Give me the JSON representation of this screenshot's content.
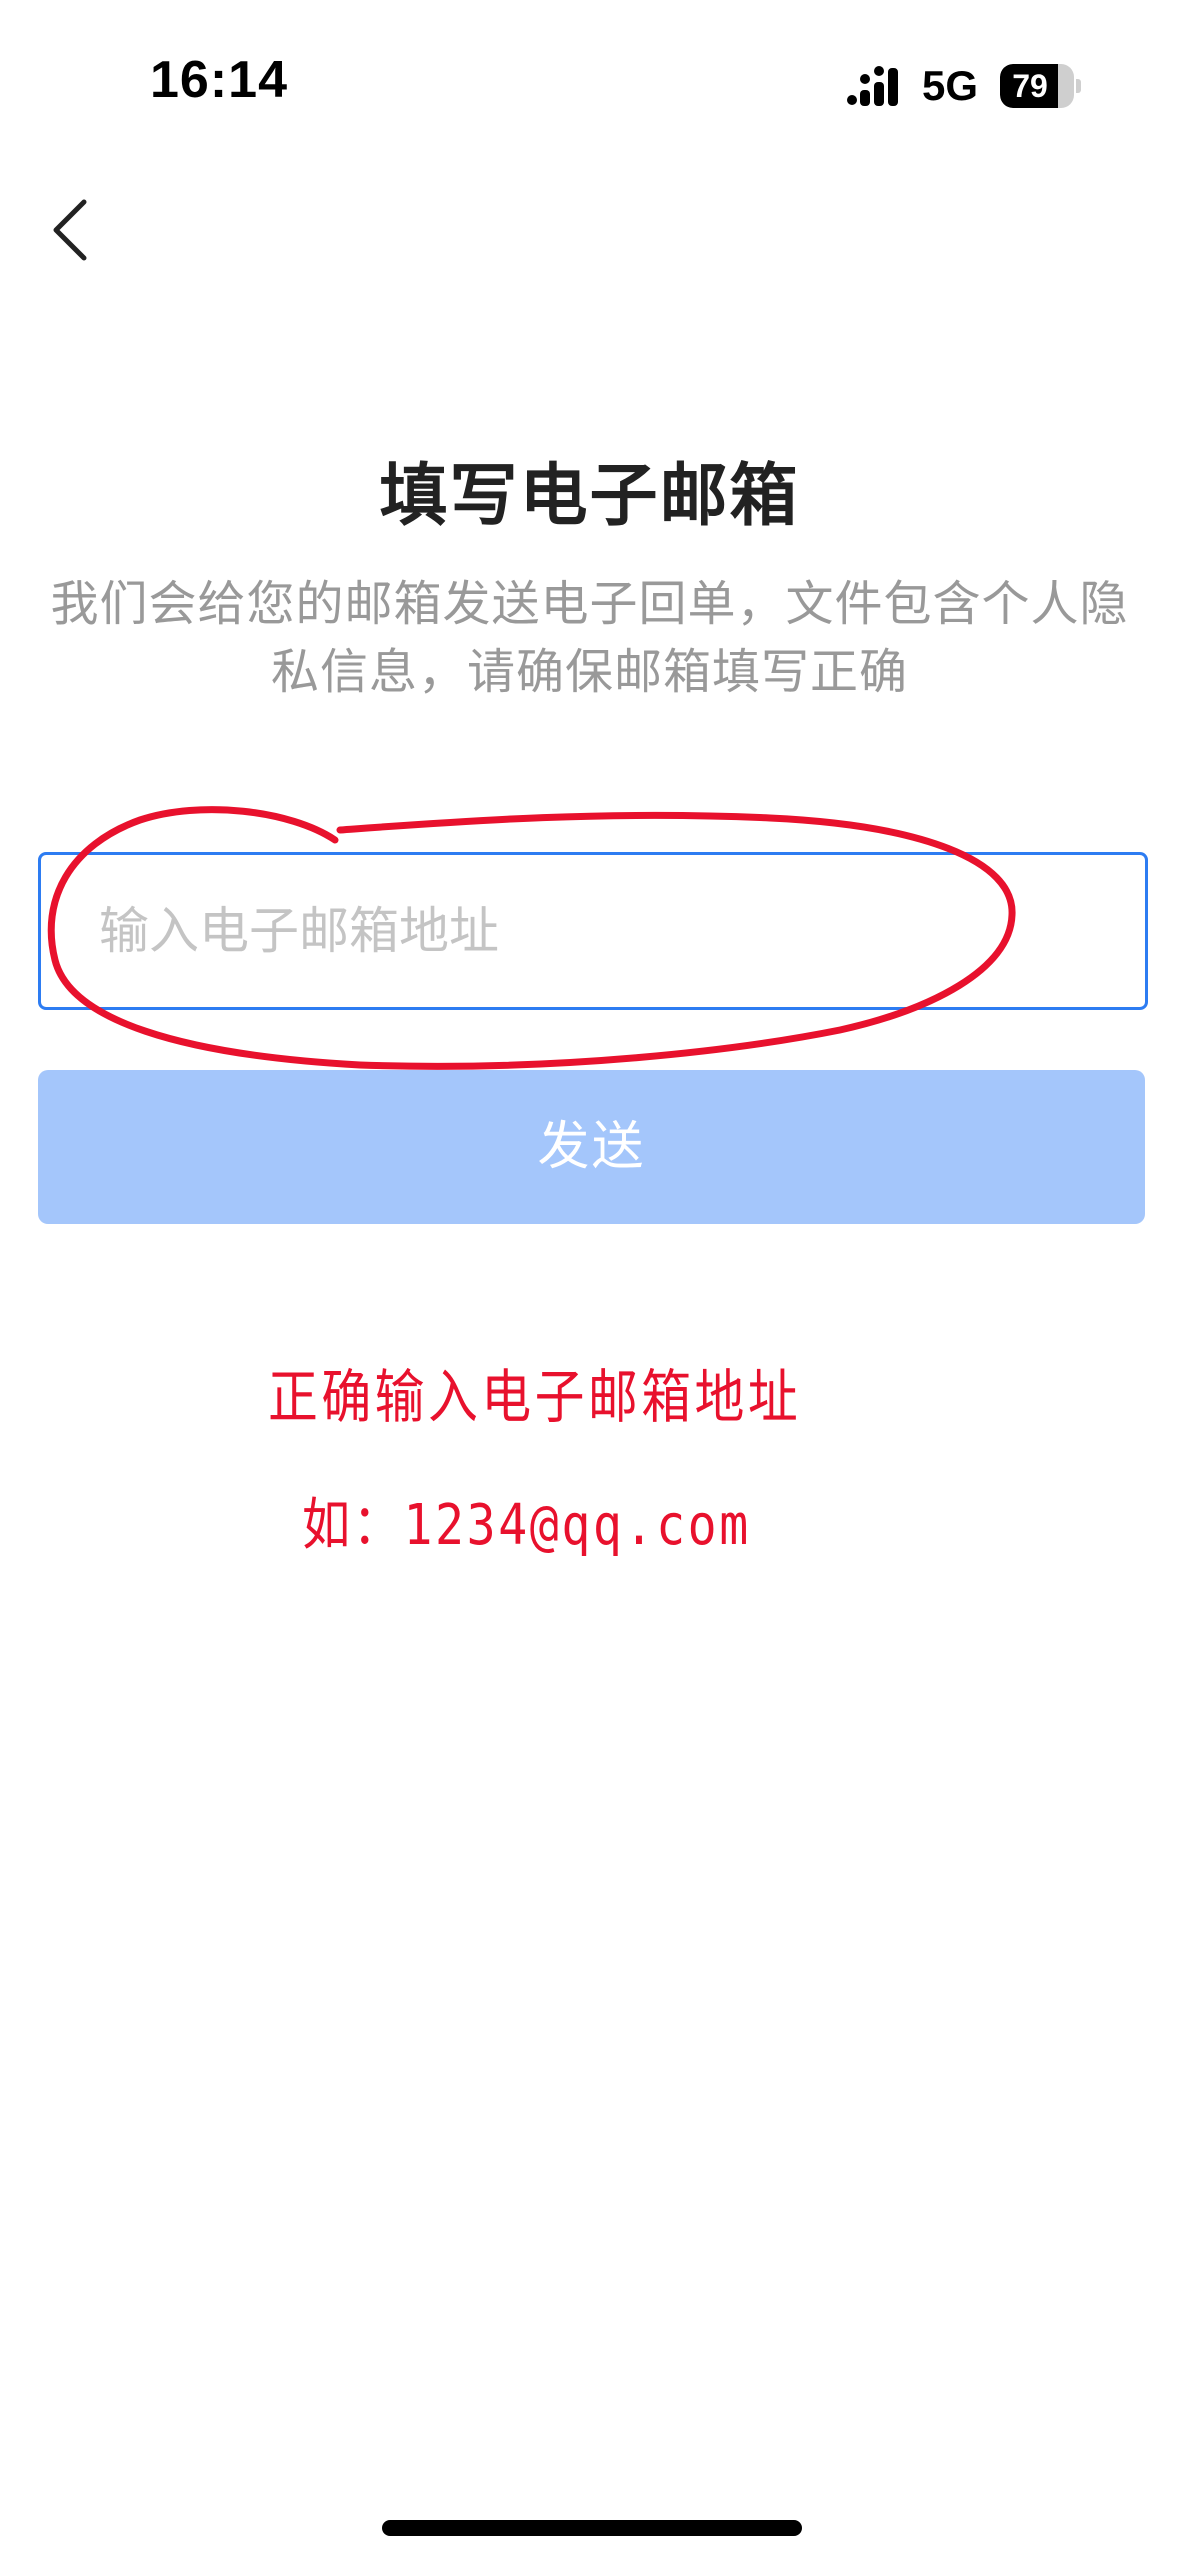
{
  "status_bar": {
    "time": "16:14",
    "network": "5G",
    "battery_level": "79",
    "battery_fraction": 0.79,
    "signal_icon": "cellular-signal-icon",
    "battery_icon": "battery-icon"
  },
  "nav": {
    "back_icon": "chevron-left-icon"
  },
  "page": {
    "title": "填写电子邮箱",
    "description": "我们会给您的邮箱发送电子回单，文件包含个人隐私信息，请确保邮箱填写正确"
  },
  "form": {
    "email_value": "",
    "email_placeholder": "输入电子邮箱地址",
    "submit_label": "发送"
  },
  "annotation": {
    "line_1": "正确输入电子邮箱地址",
    "line_2": "如：1234@qq.com",
    "color": "#e8112d"
  },
  "colors": {
    "accent": "#2d7cf2",
    "button_disabled": "#a4c6fb",
    "placeholder": "#c4c4c4",
    "secondary_text": "#999999"
  }
}
